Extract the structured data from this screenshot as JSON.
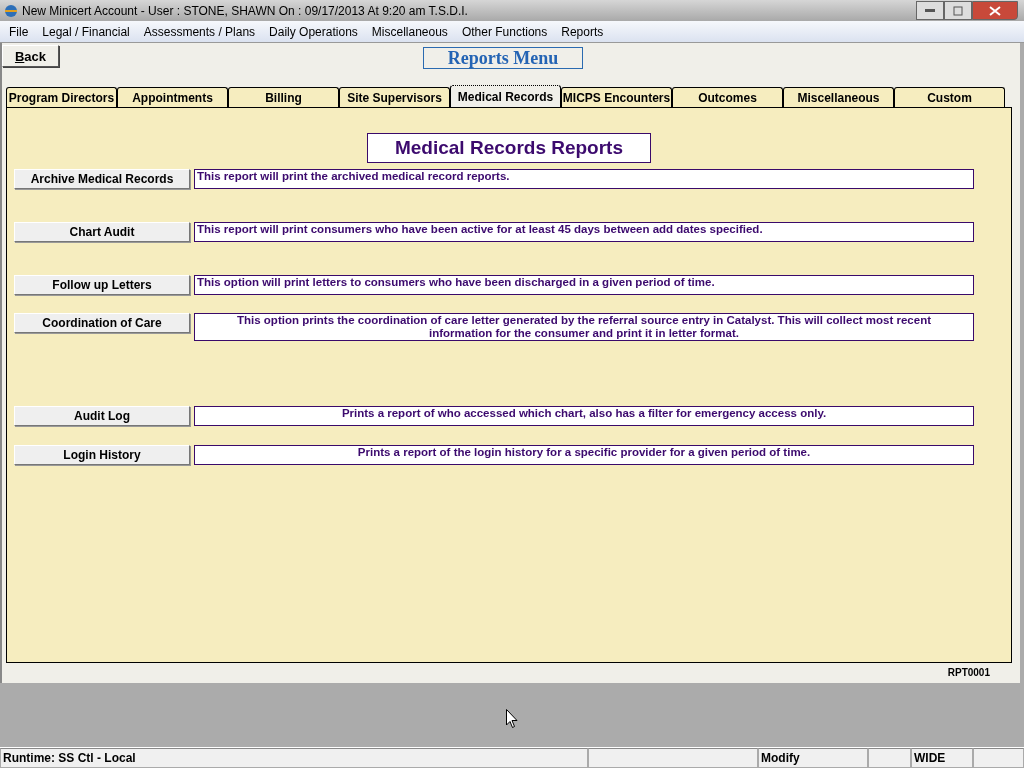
{
  "window": {
    "title": "New Minicert Account  - User : STONE, SHAWN On : 09/17/2013 At  9:20 am  T.S.D.I."
  },
  "menu": [
    "File",
    "Legal / Financial",
    "Assessments / Plans",
    "Daily Operations",
    "Miscellaneous",
    "Other Functions",
    "Reports"
  ],
  "back_button": "Back",
  "page_title": "Reports Menu",
  "tabs": [
    {
      "label": "Program Directors",
      "selected": false
    },
    {
      "label": "Appointments",
      "selected": false
    },
    {
      "label": "Billing",
      "selected": false
    },
    {
      "label": "Site Supervisors",
      "selected": false
    },
    {
      "label": "Medical Records",
      "selected": true
    },
    {
      "label": "MICPS Encounters",
      "selected": false
    },
    {
      "label": "Outcomes",
      "selected": false
    },
    {
      "label": "Miscellaneous",
      "selected": false
    },
    {
      "label": "Custom",
      "selected": false
    }
  ],
  "section_title": "Medical Records Reports",
  "reports": [
    {
      "button": "Archive Medical Records",
      "description": "This report will print the archived medical record reports.",
      "centered": false
    },
    {
      "button": "Chart Audit",
      "description": "This report will print consumers who have been active for at least 45 days between add dates specified.",
      "centered": false
    },
    {
      "button": "Follow up Letters",
      "description": "This option will print letters to consumers who have been discharged in a given period of time.",
      "centered": false
    },
    {
      "button": "Coordination of Care",
      "description": "This option prints the coordination of care letter generated by the referral source entry in Catalyst.  This will collect most recent information for the consumer and print it in letter format.",
      "centered": true
    },
    {
      "button": "Audit Log",
      "description": "Prints a report of who accessed which chart, also has a filter for emergency access only.",
      "centered": true
    },
    {
      "button": "Login History",
      "description": "Prints a report of the login history for a specific provider for a given period of time.",
      "centered": true
    }
  ],
  "form_code": "RPT0001",
  "status_bar": {
    "runtime": "Runtime: SS Ctl - Local",
    "mode": "Modify",
    "view": "WIDE"
  }
}
